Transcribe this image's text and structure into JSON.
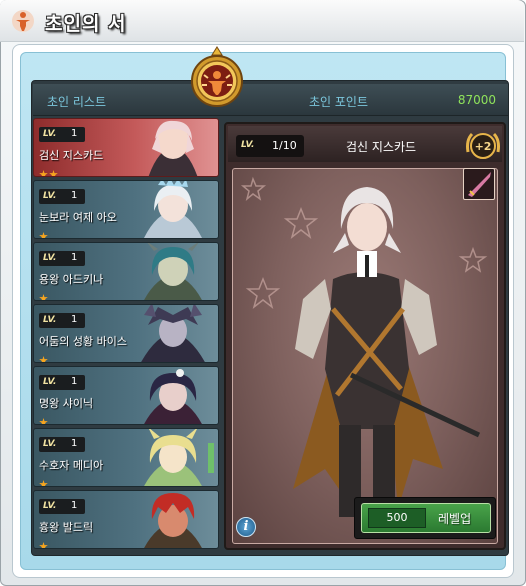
{
  "window": {
    "title": "초인의 서"
  },
  "header": {
    "list_label": "초인 리스트",
    "point_label": "초인 포인트",
    "point_value": "87000"
  },
  "characters": [
    {
      "lv_label": "LV.",
      "level": "1",
      "name": "검신 지스카드",
      "stars": 2,
      "selected": true,
      "hair": "#f0d6d8",
      "skin": "#f5d9cc"
    },
    {
      "lv_label": "LV.",
      "level": "1",
      "name": "눈보라 여제 아오",
      "stars": 1,
      "selected": false,
      "hair": "#eaeff3",
      "skin": "#f3e2da"
    },
    {
      "lv_label": "LV.",
      "level": "1",
      "name": "용왕 아드키나",
      "stars": 1,
      "selected": false,
      "hair": "#2f7b86",
      "skin": "#cfd2b8"
    },
    {
      "lv_label": "LV.",
      "level": "1",
      "name": "어둠의 성황 바이스",
      "stars": 1,
      "selected": false,
      "hair": "#3e3a54",
      "skin": "#b8b3c4"
    },
    {
      "lv_label": "LV.",
      "level": "1",
      "name": "명왕 샤이닉",
      "stars": 1,
      "selected": false,
      "hair": "#2a2644",
      "skin": "#e8cfcb"
    },
    {
      "lv_label": "LV.",
      "level": "1",
      "name": "수호자 메디아",
      "stars": 1,
      "selected": false,
      "hair": "#e9de8f",
      "skin": "#f5e4c9"
    },
    {
      "lv_label": "LV.",
      "level": "1",
      "name": "흉왕 발드릭",
      "stars": 1,
      "selected": false,
      "hair": "#c22c25",
      "skin": "#d88a6e"
    }
  ],
  "detail": {
    "lv_label": "LV.",
    "level_count": "1/10",
    "name": "검신 지스카드",
    "plus_badge": "+2",
    "info_glyph": "i",
    "levelup_cost": "500",
    "levelup_label": "레벨업"
  },
  "colors": {
    "accent_cyan": "#7cc7dd",
    "points_green": "#8fe35b",
    "selected_red": "#c45a5a",
    "star": "#f6a51f"
  },
  "icons": [
    "person-icon",
    "medallion-icon",
    "weapon-icon",
    "info-icon",
    "plus-rank-icon",
    "star-icon"
  ]
}
